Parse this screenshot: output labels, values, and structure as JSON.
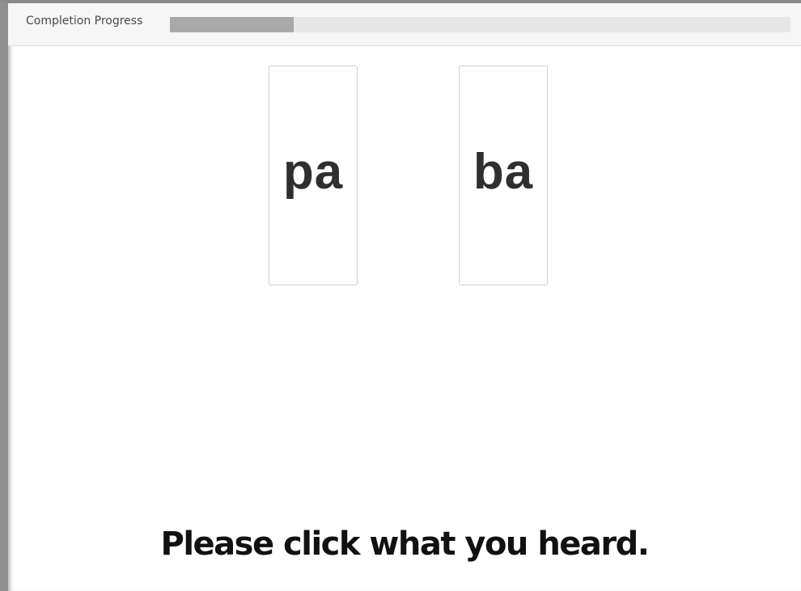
{
  "progress": {
    "label": "Completion Progress",
    "value_fraction": 0.2
  },
  "choices": [
    {
      "label": "pa"
    },
    {
      "label": "ba"
    }
  ],
  "instruction": "Please click what you heard."
}
